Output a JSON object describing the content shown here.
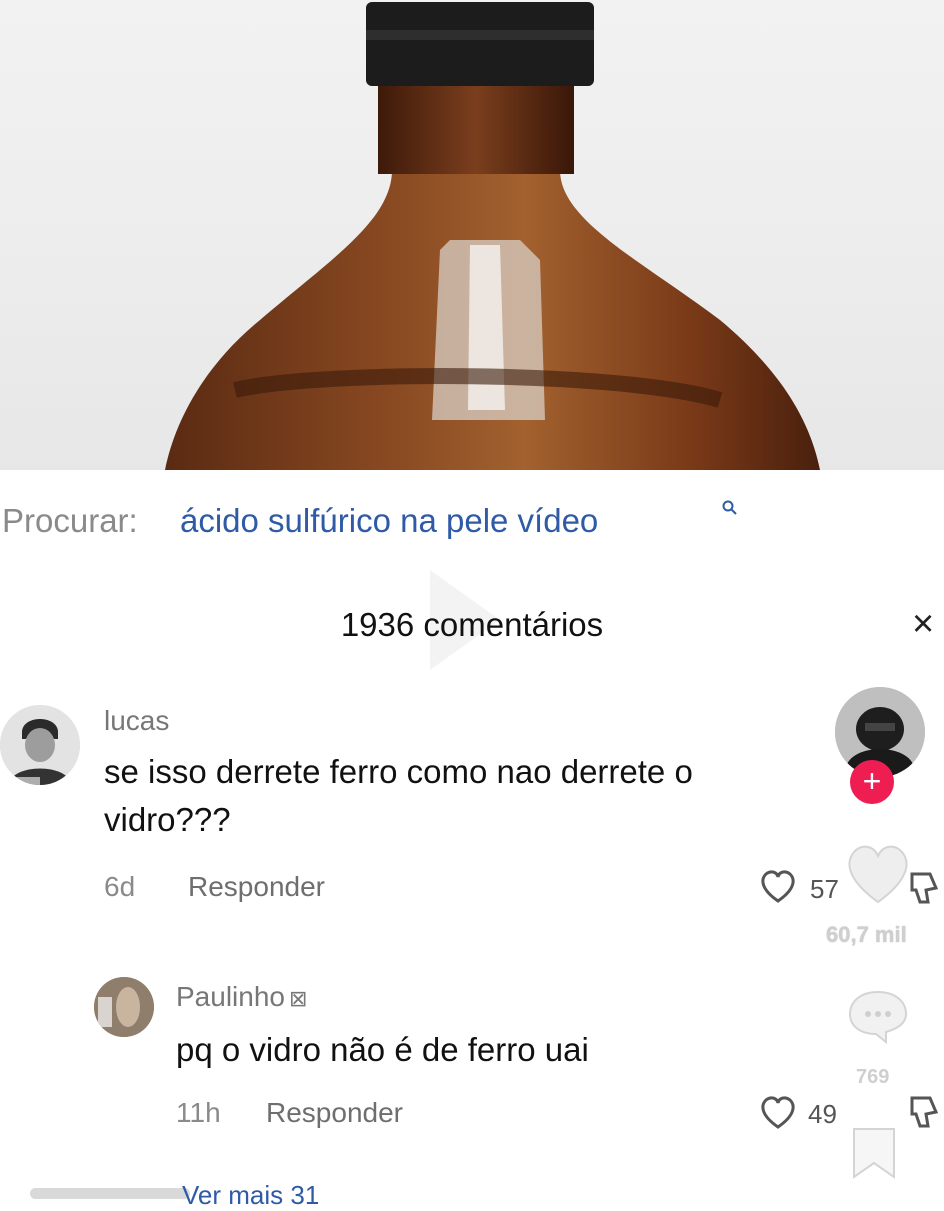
{
  "video": {
    "description_icon": "amber-bottle-image"
  },
  "search": {
    "prefix": "Procurar:",
    "query": "ácido sulfúrico na pele vídeo",
    "icon": "search-icon"
  },
  "comments": {
    "title": "1936 comentários",
    "close_icon": "×",
    "items": [
      {
        "username": "lucas",
        "text_line1": "se isso derrete ferro como nao derrete o",
        "text_line2": "vidro???",
        "time": "6d",
        "reply_label": "Responder",
        "likes": "57"
      },
      {
        "username": "Paulinho",
        "badge": "⊠",
        "text": "pq o vidro não é de ferro uai",
        "time": "11h",
        "reply_label": "Responder",
        "likes": "49"
      }
    ],
    "view_more": "Ver mais 31"
  },
  "sidebar": {
    "like_count": "60,7 mil",
    "comment_count": "769",
    "follow_plus": "+"
  },
  "colors": {
    "accent": "#ee1d52",
    "link": "#2f5aa6"
  }
}
